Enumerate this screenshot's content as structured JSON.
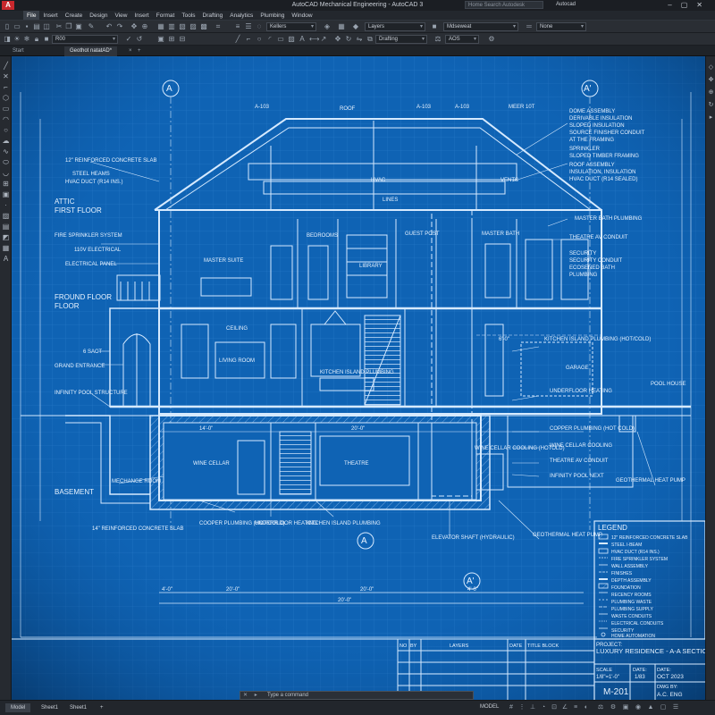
{
  "app": {
    "title": "AutoCAD Mechanical Engineering - AutoCAD 3",
    "logo": "A",
    "search_placeholder": "Home Search Autodesk",
    "user": "Autocad"
  },
  "menu": [
    "File",
    "Insert",
    "Create",
    "Design",
    "View",
    "Insert",
    "Format",
    "Tools",
    "Drafting",
    "Analytics",
    "Plumbing",
    "Window"
  ],
  "toolbar": {
    "layer_state": "R00",
    "style": "Kellers",
    "layers": "Layers",
    "linetype": "Mdseweat",
    "lineweight": "None",
    "workspace": "Drafting",
    "annotation": "AOS"
  },
  "tabs": {
    "start": "Start",
    "active": "Geothot natatAD*"
  },
  "drawing": {
    "grid_markers": [
      "A",
      "A'",
      "A",
      "A'"
    ],
    "section_labels": [
      "A-103",
      "A-103",
      "A-103",
      "MEER 10T"
    ],
    "roof_label": "ROOF",
    "hvac": "HVAC",
    "vents": "VENTS",
    "lines_note": "LINES",
    "rooms": {
      "master_suite": "MASTER SUITE",
      "bedrooms": "BEDROOMS",
      "library": "LIBRARY",
      "guest_post": "GUEST POST",
      "master_bath": "MASTER BATH",
      "living_room": "LIVING ROOM",
      "kitchen_island": "KITCHEN ISLAND PLUMBING",
      "garage": "GARAGE",
      "ceiling": "CEILING",
      "wine_cellar": "WINE CELLAR",
      "theatre": "THEATRE",
      "mechanical_room": "MECHANGE ROOM",
      "pool_house": "POOL HOUSE"
    },
    "level_labels": {
      "attic": "ATTIC",
      "first_floor": "FIRST FLOOR",
      "ground_floor": "FROUND FLOOR",
      "floor": "FLOOR",
      "basement": "BASEMENT"
    },
    "left_notes": {
      "concrete": "12\" REINFORCED CONCRETE SLAB",
      "steel": "STEEL HEAMS",
      "hvac_duct": "HVAC DUCT (R14 INS.)",
      "fire": "FIRE SPRINKLER SYSTEM",
      "electrical": "110V ELECTRICAL",
      "electrical_panel": "ELECTRICAL PANEL",
      "entrance_label": "6 SACT",
      "grand_entrance": "GRAND ENTRANCE",
      "infinity_pool": "INFINITY POOL STRUCTURE",
      "basement_slab": "14\" REINFORCED CONCRETE SLAB"
    },
    "right_notes": {
      "dome": "DOME ASSEMBLY",
      "dome2": "DERIVABLE INSULATION",
      "dome3": "SLOPED INSULATION",
      "dome4": "SOURCE FINISHER CONDUIT",
      "dome5": "AT THE FRAMING",
      "sprinkler": "SPRINKLER",
      "sloped": "SLOPED TIMBER FRAMING",
      "roof_assembly": "ROOF ASSEMBLY",
      "roof2": "INSULATION, INSULATION",
      "hvac_duct": "HVAC DUCT (R14 SEALED)",
      "master_plumb": "MASTER BATH PLUMBING",
      "master_plumb2": "MASTER BATH PLUMBING",
      "theater_conduit": "THEATRE AV CONDUIT",
      "security": "SECURITY",
      "security2": "SECURITY CONDUIT",
      "security3": "ECOSENED BATH",
      "security4": "PLUMBING",
      "kitchen_plumb": "KITCHEN ISLAND PLUMBING (HOT/COLD)",
      "underfloor": "UNDERFLOOR HEATING",
      "copper": "COPPER PLUMBING (HOT COLD)",
      "wine_cooling": "WINE CELLAR COOLING",
      "theatre_av": "THEATRE AV CONDUIT",
      "infinity_pool_next": "INFINITY POOL NEXT",
      "geothermal_pump": "GEOTHERMAL HEAT PUMP",
      "wine_coolbox": "WINE CELLAR COOLING (HOTOLD)",
      "geothermal": "GEOTHERMAL HEAT PUMP",
      "elevator": "ELEVATOR SHAFT (HYDRAULIC)",
      "copper_bottom": "COOPER PLUMBING (HOT/COLD)",
      "underfloor_bottom": "UNDERFLOOR HEATING",
      "kitchen_bottom": "KITCHEN ISLAND PLUMBING"
    },
    "dimensions": {
      "d1": "20'-0\"",
      "d2": "20'-0\"",
      "d3": "20'-0\"",
      "d4": "14'-0\"",
      "d5": "4'-0\"",
      "d6": "4'-0\"",
      "d7": "20'-0\"",
      "d8": "6'-0\""
    }
  },
  "legend": {
    "title": "LEGEND",
    "items": [
      "12\" REINFORCED CONCRETE SLAB",
      "STEEL I-BEAM",
      "HVAC DUCT (R14 INS.)",
      "FIRE SPRINKLER SYSTEM",
      "WALL ASSEMBLY",
      "FINISHES",
      "DEPTH ASSEMBLY",
      "FOUNDATION",
      "RECENCY ROOMS",
      "PLUMBING WASTE",
      "PLUMBING SUPPLY",
      "WASTE CONDUITS",
      "ELECTRICAL CONDUITS",
      "SECURITY",
      "HOME AUTOMATION"
    ]
  },
  "title_block": {
    "title_label": "TITLE BLOCK",
    "col_no": "NO",
    "col_by": "BY",
    "col_layers": "LAYERS",
    "col_date": "DATE",
    "project_label": "PROJECT:",
    "project_name": "LUXURY RESIDENCE - A-A SECTION",
    "scale_label": "SCALE",
    "scale_value": "1/8\"=1'-0\"",
    "date_label": "DATE:",
    "date_value": "1/83",
    "date2_label": "DATE:",
    "date2_value": "OCT 2023",
    "sheet": "M-201",
    "dwg_label": "DWG BY:",
    "dwg_value": "A.C. ENG"
  },
  "command": {
    "placeholder": "Type a command"
  },
  "status": {
    "layouts": [
      "Model",
      "Sheet1",
      "Sheet1"
    ],
    "model": "MODEL"
  },
  "colors": {
    "blueprint": "#0f63b4",
    "blueprint_dark": "#0a4f95",
    "line": "#cfe6ff",
    "chrome": "#22262c"
  }
}
